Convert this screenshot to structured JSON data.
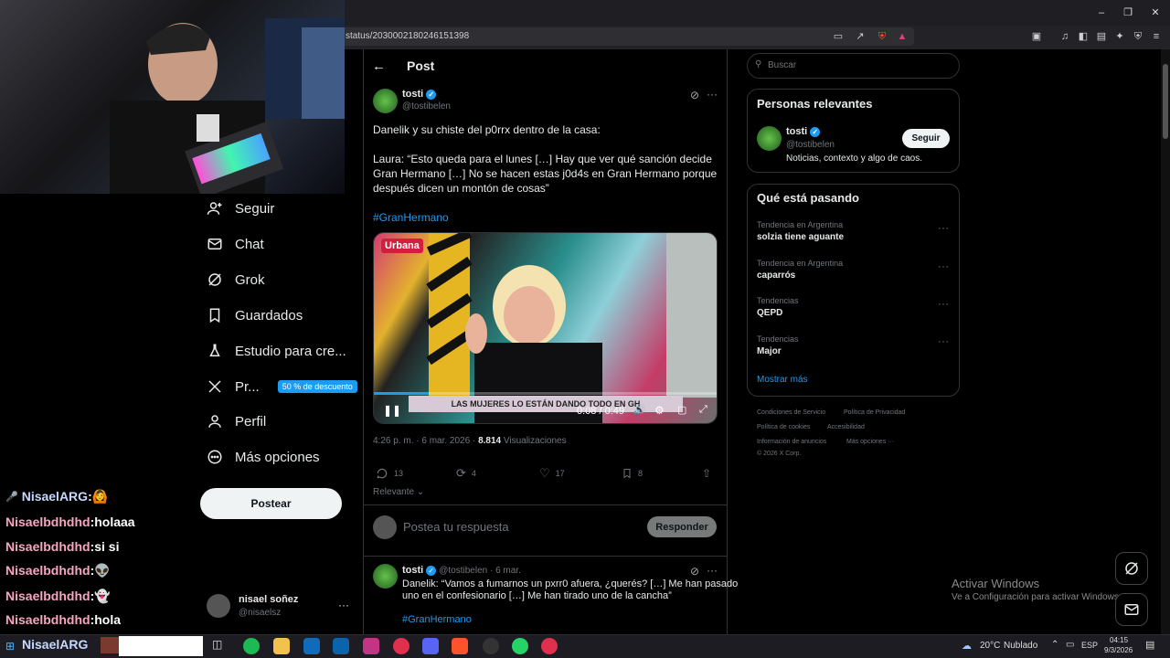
{
  "browser": {
    "url": "status/2030002180246151398",
    "window_controls": [
      "minimize",
      "maximize",
      "close"
    ]
  },
  "sidebar": {
    "items": [
      {
        "label": "Seguir",
        "icon": "add-user-icon"
      },
      {
        "label": "Chat",
        "icon": "mail-icon"
      },
      {
        "label": "Grok",
        "icon": "grok-icon"
      },
      {
        "label": "Guardados",
        "icon": "bookmark-icon"
      },
      {
        "label": "Estudio para cre...",
        "icon": "flask-icon"
      },
      {
        "label": "Pr...",
        "icon": "x-logo-icon",
        "badge": "50 % de descuento"
      },
      {
        "label": "Perfil",
        "icon": "person-icon"
      },
      {
        "label": "Más opciones",
        "icon": "more-circle-icon"
      }
    ],
    "post_button": "Postear",
    "account": {
      "name": "nisael soñez",
      "handle": "@nisaelsz"
    }
  },
  "chat": [
    {
      "user": "NisaelARG",
      "sep": " :",
      "msg": " 🙆",
      "style": "blue"
    },
    {
      "user": "Nisaelbdhdhd",
      "sep": " :",
      "msg": " holaaa",
      "style": "pink"
    },
    {
      "user": "Nisaelbdhdhd",
      "sep": " :",
      "msg": " si si",
      "style": "pink"
    },
    {
      "user": "Nisaelbdhdhd",
      "sep": " :",
      "msg": " 👽",
      "style": "pink"
    },
    {
      "user": "Nisaelbdhdhd",
      "sep": " :",
      "msg": " 👻",
      "style": "pink"
    },
    {
      "user": "Nisaelbdhdhd",
      "sep": " :",
      "msg": " hola",
      "style": "pink"
    }
  ],
  "post": {
    "header": "Post",
    "author": {
      "name": "tosti",
      "handle": "@tostibelen"
    },
    "text_line1": "Danelik y su chiste del p0rrx dentro de la casa:",
    "text_line2": "Laura: “Esto queda para el lunes […] Hay que ver qué sanción decide",
    "text_line3": "Gran Hermano […] No se hacen estas j0d4s en Gran Hermano porque",
    "text_line4": "después dicen un montón de cosas”",
    "hashtag": "#GranHermano",
    "video": {
      "caption": "LAS MUJERES LO ESTÁN DANDO TODO EN GH",
      "time": "0:08 / 0:49",
      "progress": 0.16,
      "logo": "Urbana"
    },
    "timestamp": "4:26 p. m. · 6 mar. 2026 · ",
    "views": "8.814",
    "views_label": " Visualizaciones",
    "replies": "13",
    "reposts": "4",
    "likes": "17",
    "bookmarks": "8",
    "sort": "Relevante",
    "reply_placeholder": "Postea tu respuesta",
    "reply_button": "Responder"
  },
  "reply": {
    "name": "tosti",
    "meta": "@tostibelen · 6 mar.",
    "line1": "Danelik: “Vamos a fumarnos un pxrr0 afuera, ¿querés? […] Me han pasado",
    "line2": "uno en el confesionario […] Me han tirado uno de la cancha”",
    "hashtag": "#GranHermano"
  },
  "right": {
    "search_placeholder": "Buscar",
    "relevant_title": "Personas relevantes",
    "relevant": {
      "name": "tosti",
      "handle": "@tostibelen",
      "bio": "Noticias, contexto y algo de caos.",
      "follow": "Seguir"
    },
    "trends_title": "Qué está pasando",
    "trends": [
      {
        "label": "Tendencia en Argentina",
        "name": "solzia tiene aguante"
      },
      {
        "label": "Tendencia en Argentina",
        "name": "caparrós"
      },
      {
        "label": "Tendencias",
        "name": "QEPD"
      },
      {
        "label": "Tendencias",
        "name": "Major"
      }
    ],
    "show_more": "Mostrar más",
    "footer": [
      "Condiciones de Servicio",
      "Política de Privacidad",
      "Política de cookies",
      "Accesibilidad",
      "Información de anuncios",
      "Más opciones ···",
      "© 2026 X Corp."
    ]
  },
  "windows_activation": {
    "title": "Activar Windows",
    "subtitle": "Ve a Configuración para activar Windows."
  },
  "taskbar": {
    "chat_user": "NisaelARG",
    "weather": "20°C",
    "weather_label": "Nublado",
    "lang": "ESP",
    "time": "04:15",
    "date": "9/3/2026"
  },
  "colors": {
    "accent": "#1d9bf0",
    "background": "#000000",
    "border": "#2f3336",
    "muted": "#71767b"
  }
}
